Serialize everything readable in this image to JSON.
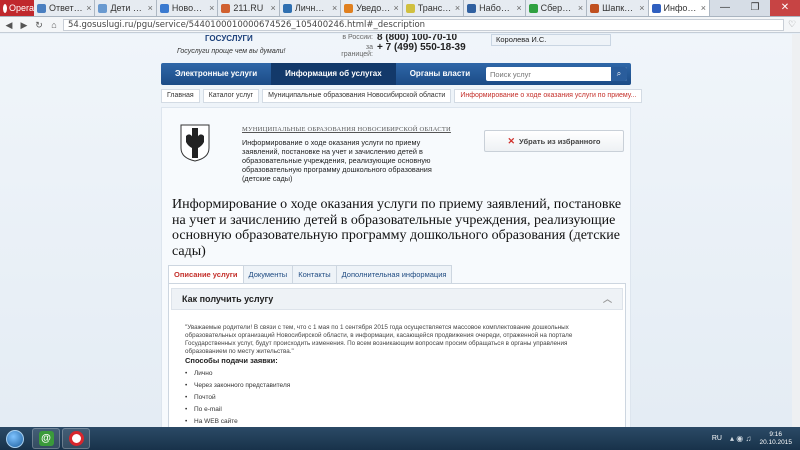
{
  "browser": {
    "opera_label": "Opera",
    "tabs": [
      {
        "label": "Ответить - ",
        "color": "#4a7fc0",
        "active": false
      },
      {
        "label": "Дети и род",
        "color": "#6a9ad0",
        "active": false
      },
      {
        "label": "Новостройк",
        "color": "#3a7ad0",
        "active": false
      },
      {
        "label": "211.RU",
        "color": "#d06030",
        "active": false
      },
      {
        "label": "Личный каб",
        "color": "#2f6fb0",
        "active": false
      },
      {
        "label": "Уведомлен",
        "color": "#e08020",
        "active": false
      },
      {
        "label": "Транспорт",
        "color": "#d0c040",
        "active": false
      },
      {
        "label": "Набор для",
        "color": "#3060a0",
        "active": false
      },
      {
        "label": "Сбербанк",
        "color": "#2fa040",
        "active": false
      },
      {
        "label": "Шапки, шарф",
        "color": "#c05020",
        "active": false
      },
      {
        "label": "Информаци",
        "color": "#3060c0",
        "active": true
      }
    ],
    "window_controls": {
      "minimize": "—",
      "restore": "❐",
      "close": "✕"
    },
    "url": "54.gosuslugi.ru/pgu/service/5440100010000674526_105400246.html#_description"
  },
  "header": {
    "logo_text": "ГОСУСЛУГИ",
    "slogan": "Госуслуги проще чем вы думали!",
    "phone1_label": "в России:",
    "phone1": "8 (800) 100-70-10",
    "phone2_label": "за границей:",
    "phone2": "+ 7 (499) 550-18-39",
    "user": "Королева И.С."
  },
  "nav": {
    "items": [
      "Электронные услуги",
      "Информация об услугах",
      "Органы власти"
    ],
    "search_placeholder": "Поиск услуг"
  },
  "breadcrumbs": [
    "Главная",
    "Каталог услуг",
    "Муниципальные образования Новосибирской области",
    "Информирование о ходе оказания услуги по приему..."
  ],
  "org": {
    "title": "МУНИЦИПАЛЬНЫЕ ОБРАЗОВАНИЯ НОВОСИБИРСКОЙ ОБЛАСТИ",
    "description": "Информирование о ходе оказания услуги по приему заявлений, постановке на учет и зачислению детей в образовательные учреждения, реализующие основную образовательную программу дошкольного образования (детские сады)",
    "fav_button": "Убрать из избранного"
  },
  "main_title": "Информирование о ходе оказания услуги по приему заявлений, постановке на учет и зачислению детей в образовательные учреждения, реализующие основную образовательную программу дошкольного образования (детские сады)",
  "tabs": [
    "Описание услуги",
    "Документы",
    "Контакты",
    "Дополнительная информация"
  ],
  "how": {
    "header": "Как получить услугу",
    "quote": "\"Уважаемые родители! В связи с тем, что с 1 мая по 1 сентября 2015 года осуществляется массовое комплектование дошкольных образовательных организаций Новосибирской области, в информации, касающейся продвижения очереди, отраженной на портале Государственных услуг, будут происходить изменения. По всем возникающим вопросам просим обращаться в органы управления образованием по месту жительства.\"",
    "methods_title": "Способы подачи заявки:",
    "methods": [
      "Лично",
      "Через законного представителя",
      "Почтой",
      "По e-mail",
      "На WEB сайте"
    ]
  },
  "taskbar": {
    "lang": "RU",
    "time": "9:16",
    "date": "20.10.2015"
  }
}
